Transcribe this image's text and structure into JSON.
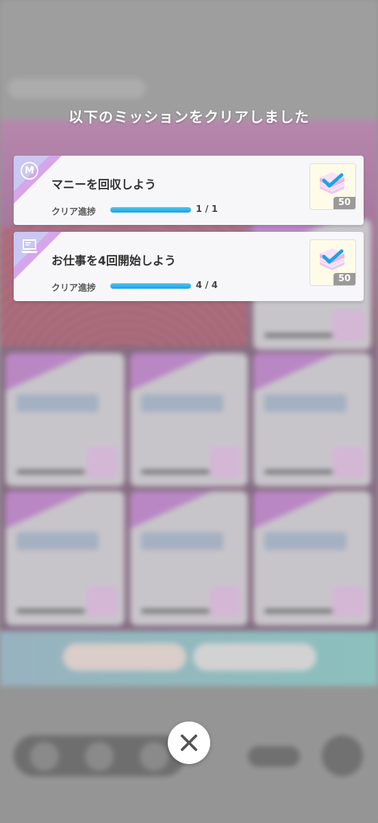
{
  "dialog": {
    "title": "以下のミッションをクリアしました",
    "progress_label": "クリア進捗"
  },
  "missions": [
    {
      "icon": "money-m-icon",
      "icon_glyph": "M",
      "title": "マニーを回収しよう",
      "progress_text": "1 / 1",
      "progress": 1.0,
      "reward_qty": "50"
    },
    {
      "icon": "laptop-icon",
      "title": "お仕事を4回開始しよう",
      "progress_text": "4 / 4",
      "progress": 1.0,
      "reward_qty": "50"
    }
  ],
  "close": {
    "icon": "close-icon"
  },
  "colors": {
    "accent_blue": "#1aa2e4",
    "corner_pink": "#d7a5ea",
    "reward_bg": "#fffbe9"
  }
}
